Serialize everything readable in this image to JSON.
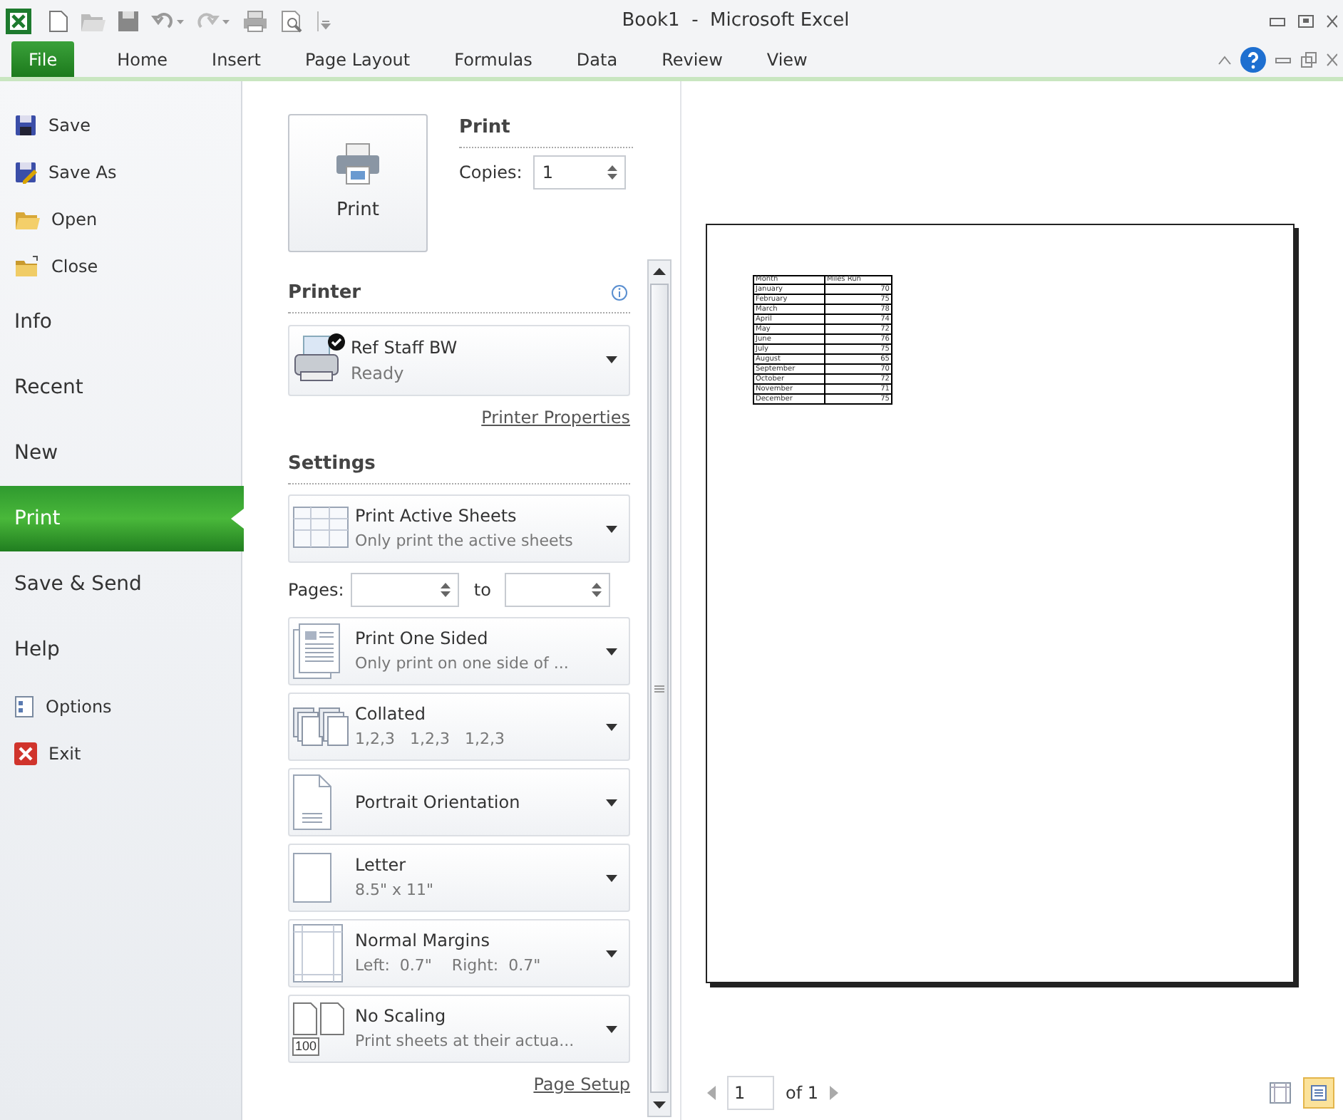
{
  "title_bar": {
    "title": "Book1  -  Microsoft Excel"
  },
  "ribbon_tabs": [
    {
      "label": "File",
      "selected": true
    },
    {
      "label": "Home",
      "selected": false
    },
    {
      "label": "Insert",
      "selected": false
    },
    {
      "label": "Page Layout",
      "selected": false
    },
    {
      "label": "Formulas",
      "selected": false
    },
    {
      "label": "Data",
      "selected": false
    },
    {
      "label": "Review",
      "selected": false
    },
    {
      "label": "View",
      "selected": false
    }
  ],
  "backstage_menu": [
    {
      "label": "Save",
      "kind": "command"
    },
    {
      "label": "Save As",
      "kind": "command"
    },
    {
      "label": "Open",
      "kind": "command"
    },
    {
      "label": "Close",
      "kind": "command"
    },
    {
      "label": "Info",
      "kind": "section",
      "selected": false
    },
    {
      "label": "Recent",
      "kind": "section",
      "selected": false
    },
    {
      "label": "New",
      "kind": "section",
      "selected": false
    },
    {
      "label": "Print",
      "kind": "section",
      "selected": true
    },
    {
      "label": "Save & Send",
      "kind": "section",
      "selected": false
    },
    {
      "label": "Help",
      "kind": "section",
      "selected": false
    },
    {
      "label": "Options",
      "kind": "command"
    },
    {
      "label": "Exit",
      "kind": "command"
    }
  ],
  "print_panel": {
    "heading": "Print",
    "print_button": "Print",
    "copies_label": "Copies:",
    "copies_value": "1"
  },
  "printer": {
    "heading": "Printer",
    "name": "Ref Staff BW",
    "status": "Ready",
    "properties_link": "Printer Properties"
  },
  "settings": {
    "heading": "Settings",
    "items": [
      {
        "kind": "dropdown",
        "title": "Print Active Sheets",
        "subtitle": "Only print the active sheets"
      },
      {
        "kind": "page_range",
        "pages_label": "Pages:",
        "to_label": "to"
      },
      {
        "kind": "dropdown",
        "title": "Print One Sided",
        "subtitle": "Only print on one side of ..."
      },
      {
        "kind": "dropdown",
        "title": "Collated",
        "subtitle": "1,2,3   1,2,3   1,2,3"
      },
      {
        "kind": "dropdown",
        "title": "Portrait Orientation"
      },
      {
        "kind": "dropdown",
        "title": "Letter",
        "subtitle": "8.5\" x 11\""
      },
      {
        "kind": "dropdown",
        "title": "Normal Margins",
        "subtitle": "Left:  0.7\"    Right:  0.7\""
      },
      {
        "kind": "dropdown",
        "title": "No Scaling",
        "subtitle": "Print sheets at their actua...",
        "icon_text": "100"
      }
    ],
    "page_setup_link": "Page Setup"
  },
  "preview": {
    "table": {
      "columns": [
        "Month",
        "Miles Run"
      ],
      "rows": [
        [
          "January",
          "70"
        ],
        [
          "February",
          "75"
        ],
        [
          "March",
          "78"
        ],
        [
          "April",
          "74"
        ],
        [
          "May",
          "72"
        ],
        [
          "June",
          "76"
        ],
        [
          "July",
          "75"
        ],
        [
          "August",
          "65"
        ],
        [
          "September",
          "70"
        ],
        [
          "October",
          "72"
        ],
        [
          "November",
          "71"
        ],
        [
          "December",
          "75"
        ]
      ]
    },
    "page_field": "1",
    "page_count": "of 1"
  }
}
